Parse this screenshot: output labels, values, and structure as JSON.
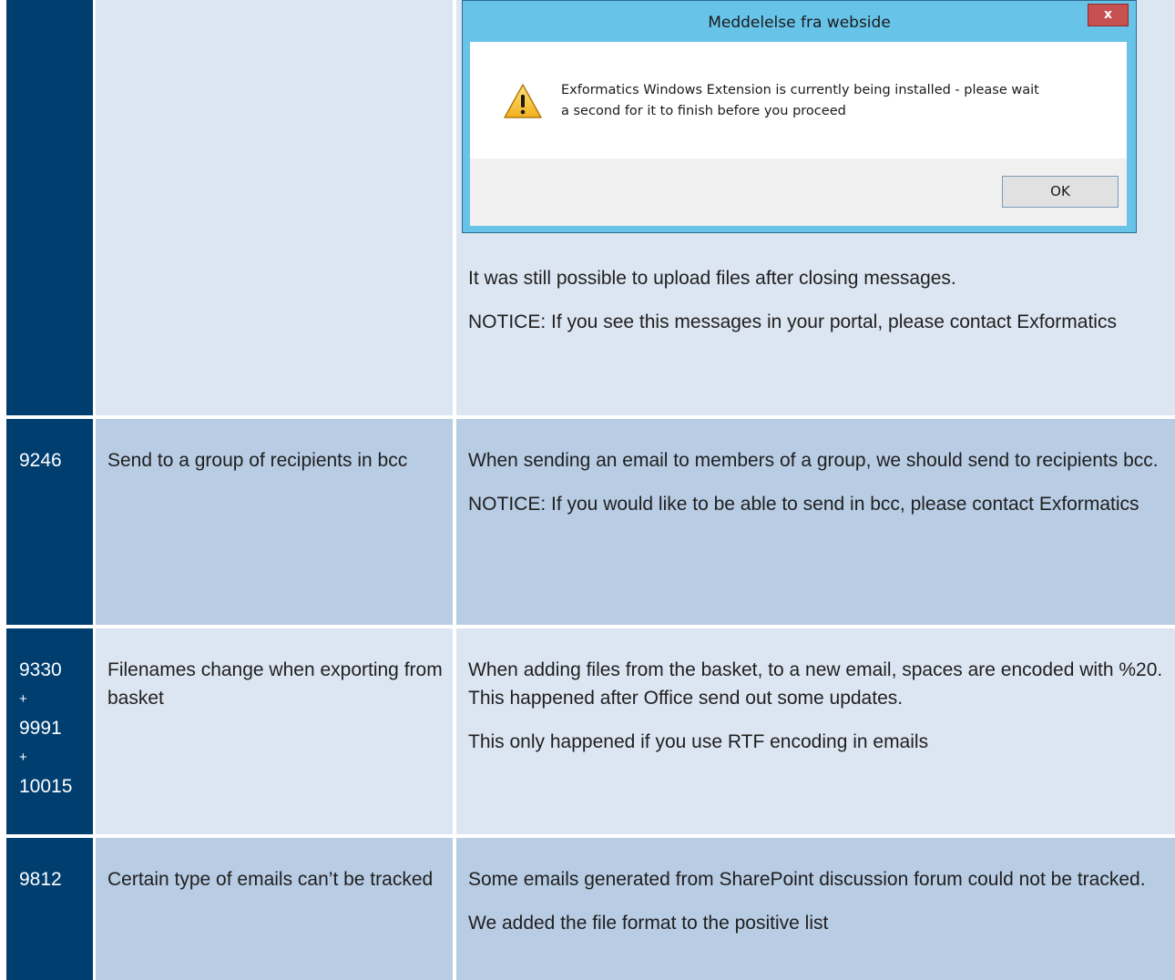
{
  "dialog": {
    "title": "Meddelelse fra webside",
    "close_label": "x",
    "message_line1": "Exformatics Windows Extension is currently being installed - please wait",
    "message_line2": "a second for it to finish before you proceed",
    "ok_label": "OK",
    "icon": "warning-icon"
  },
  "row0": {
    "desc": [
      "It was still possible to upload files after closing messages.",
      "NOTICE: If you see this messages in your portal, please contact Exformatics"
    ]
  },
  "rows": [
    {
      "id": "9246",
      "title": "Send to a group of recipients in bcc",
      "desc": [
        "When sending an email to members of a group, we should send to recipients bcc.",
        "NOTICE: If you would like to be able to send in bcc, please contact Exformatics"
      ]
    },
    {
      "id_parts": [
        "9330",
        "+",
        "9991",
        "+",
        "10015"
      ],
      "title": "Filenames change when exporting from basket",
      "desc": [
        "When adding files from the basket, to a new email, spaces are encoded with %20. This happened after Office send out some updates.",
        "This only happened if you use RTF encoding in emails"
      ]
    },
    {
      "id": "9812",
      "title": "Certain type of emails can’t be tracked",
      "desc": [
        "Some emails generated from SharePoint discussion forum could not be tracked.",
        "We added the file format to the positive list"
      ]
    }
  ],
  "colors": {
    "id_column": "#003e6f",
    "light_cell": "#dce6f2",
    "mid_cell": "#b8cce4",
    "dialog_frame": "#68c3e9",
    "close_button": "#c75050"
  }
}
